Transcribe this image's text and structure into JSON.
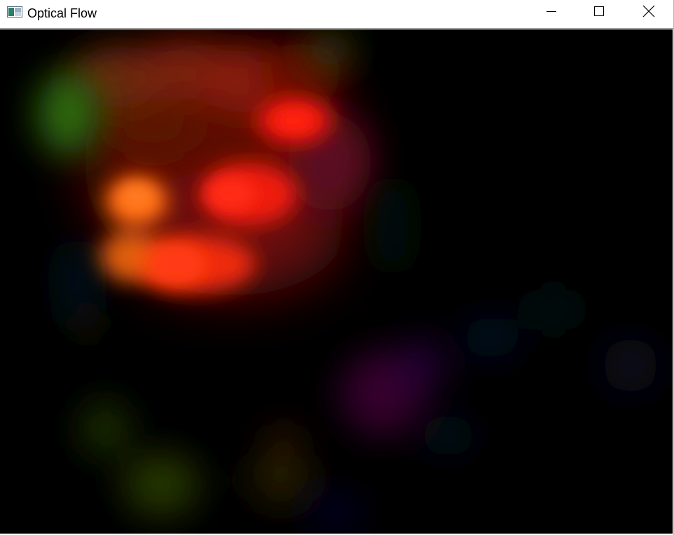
{
  "window": {
    "title": "Optical Flow",
    "app_icon": "opencv-window-icon",
    "controls": {
      "minimize_icon": "minimize-icon",
      "maximize_icon": "maximize-icon",
      "close_icon": "close-icon"
    }
  },
  "image": {
    "description_icon": "optical-flow-hsv-visualization",
    "colors": {
      "background": "#000000",
      "red": "#ff1a0a",
      "orange": "#ff6a10",
      "dark_red": "#a01808",
      "green": "#3f8a10",
      "purple": "#5a0a3a",
      "blue": "#0a1a5a"
    }
  }
}
